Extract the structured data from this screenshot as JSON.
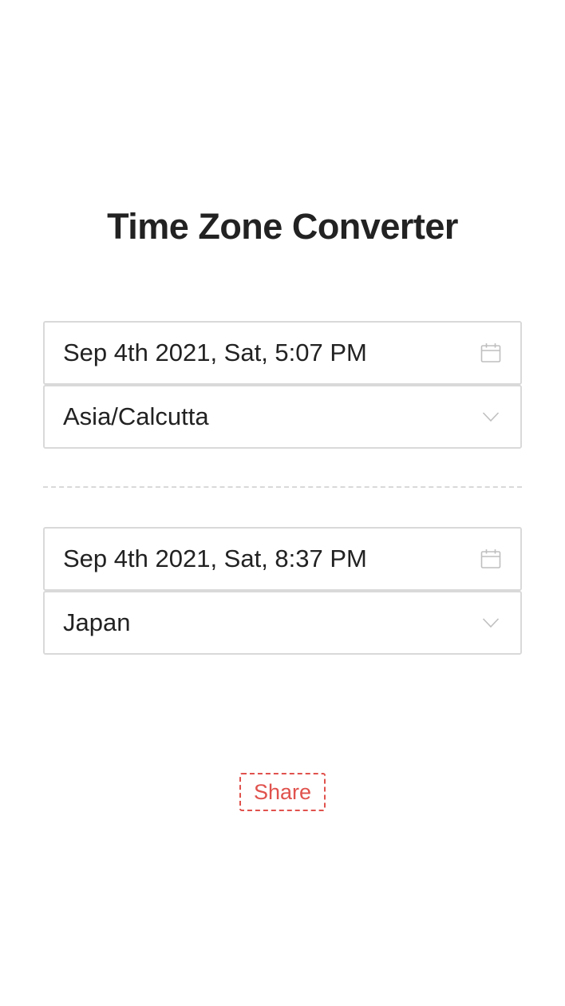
{
  "header": {
    "title": "Time Zone Converter"
  },
  "source": {
    "datetime": "Sep 4th 2021, Sat, 5:07 PM",
    "timezone": "Asia/Calcutta"
  },
  "target": {
    "datetime": "Sep 4th 2021, Sat, 8:37 PM",
    "timezone": "Japan"
  },
  "actions": {
    "share_label": "Share"
  },
  "icons": {
    "datetime_picker": "calendar-icon",
    "timezone_select": "chevron-down-icon"
  },
  "colors": {
    "text": "#222222",
    "border": "#d9d9d9",
    "icon": "#bfbfbf",
    "accent": "#e0524d"
  }
}
